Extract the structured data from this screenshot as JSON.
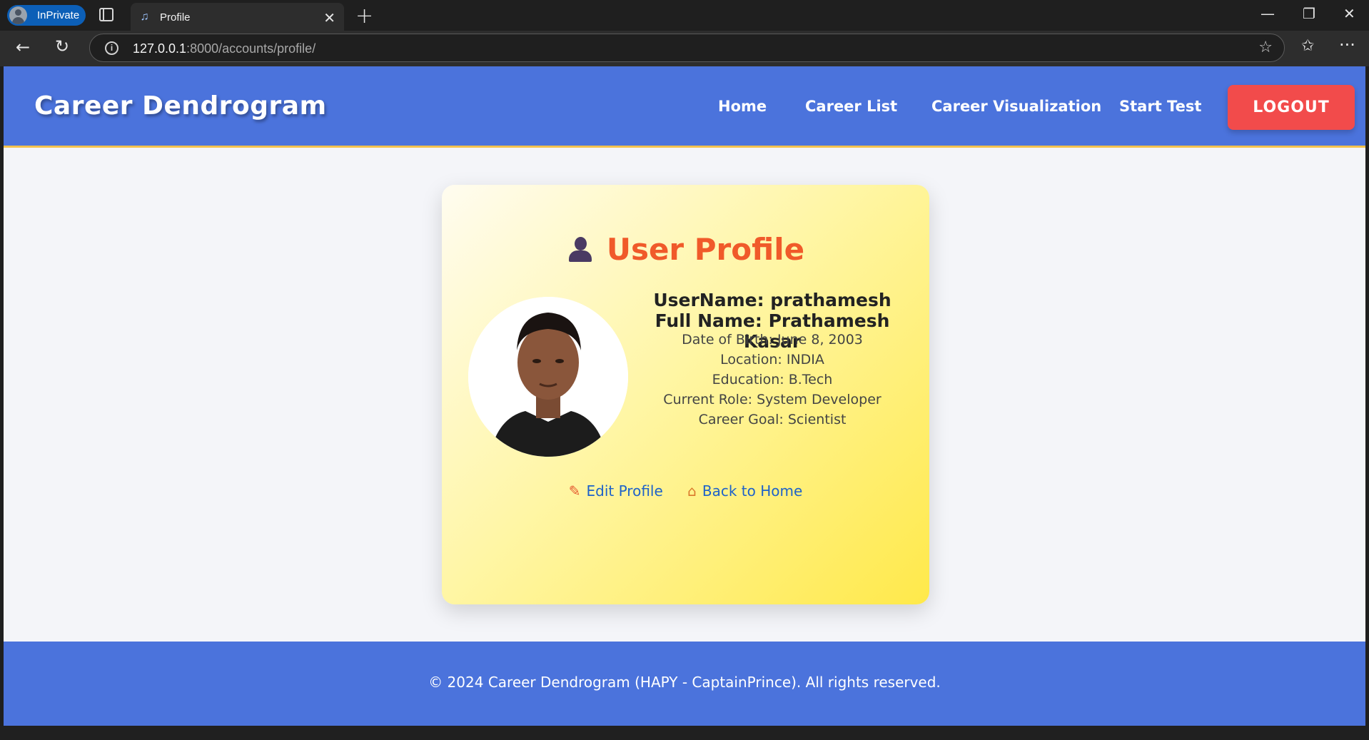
{
  "browser": {
    "inprivate_label": "InPrivate",
    "tab_title": "Profile",
    "url_host": "127.0.0.1",
    "url_rest": ":8000/accounts/profile/"
  },
  "site": {
    "brand": "Career Dendrogram",
    "nav": [
      "Home",
      "Career List",
      "Career Visualization",
      "Start Test"
    ],
    "logout": "LOGOUT"
  },
  "profile": {
    "title": "User Profile",
    "username": "UserName: prathamesh",
    "full_name": "Full Name: Prathamesh Kasar",
    "dob": "Date of Birth: June 8, 2003",
    "location": "Location: INDIA",
    "education": "Education: B.Tech",
    "current_role": "Current Role: System Developer",
    "career_goal": "Career Goal: Scientist",
    "edit_link": "Edit Profile",
    "home_link": "Back to Home"
  },
  "footer": {
    "text": "© 2024 Career Dendrogram (HAPY - CaptainPrince). All rights reserved."
  },
  "colors": {
    "header": "#4b73dc",
    "logout": "#f24b4b",
    "title": "#f05a2a",
    "link": "#1e62c9"
  }
}
